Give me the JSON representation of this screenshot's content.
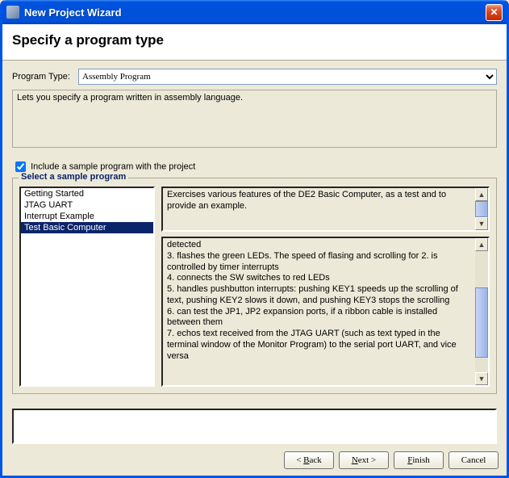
{
  "window": {
    "title": "New Project Wizard"
  },
  "header": {
    "heading": "Specify a program type"
  },
  "program_type": {
    "label": "Program Type:",
    "selected": "Assembly Program",
    "description": "Lets you specify a program written in assembly language."
  },
  "include_sample": {
    "checked": true,
    "label": "Include a sample program with the project"
  },
  "group": {
    "legend": "Select a sample program",
    "list": {
      "items": [
        "Getting Started",
        "JTAG UART",
        "Interrupt Example",
        "Test Basic Computer"
      ],
      "selected_index": 3
    },
    "summary": "Exercises various features of the DE2 Basic Computer, as a test and to provide an example.",
    "details_lines": [
      "detected",
      "3. flashes the green LEDs. The speed of flasing and scrolling for 2. is controlled by timer interrupts",
      "4. connects the SW switches to red LEDs",
      "5. handles pushbutton interrupts: pushing KEY1 speeds up the scrolling of text, pushing KEY2 slows it down, and pushing KEY3 stops the scrolling",
      "6. can test the JP1, JP2 expansion ports, if a ribbon cable is installed between them",
      "7. echos text received from the JTAG UART (such as text typed in the terminal window of the Monitor Program) to the serial port UART, and vice versa"
    ]
  },
  "buttons": {
    "back": "< Back",
    "next": "Next >",
    "finish": "Finish",
    "cancel": "Cancel"
  }
}
